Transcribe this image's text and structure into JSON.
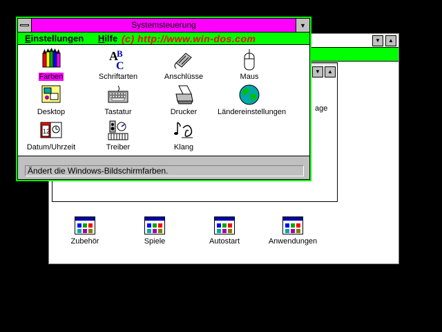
{
  "control_panel": {
    "title": "Systemsteuerung",
    "menu": [
      {
        "accel": "E",
        "rest": "instellungen"
      },
      {
        "accel": "H",
        "rest": "ilfe"
      }
    ],
    "brand_text": "(c) http://www.win-dos.com",
    "icons": [
      {
        "label": "Farben",
        "icon": "color-pencils-icon",
        "selected": true
      },
      {
        "label": "Schriftarten",
        "icon": "fonts-icon"
      },
      {
        "label": "Anschlüsse",
        "icon": "ports-icon"
      },
      {
        "label": "Maus",
        "icon": "mouse-icon"
      },
      {
        "label": "Desktop",
        "icon": "desktop-icon"
      },
      {
        "label": "Tastatur",
        "icon": "keyboard-icon"
      },
      {
        "label": "Drucker",
        "icon": "printer-icon"
      },
      {
        "label": "Ländereinstellungen",
        "icon": "globe-icon"
      },
      {
        "label": "Datum/Uhrzeit",
        "icon": "calendar-clock-icon"
      },
      {
        "label": "Treiber",
        "icon": "drivers-icon"
      },
      {
        "label": "Klang",
        "icon": "sound-icon"
      }
    ],
    "status": "Ändert die Windows-Bildschirmfarben."
  },
  "group_window": {
    "partial_label": "age"
  },
  "program_groups": [
    {
      "label": "Zubehör"
    },
    {
      "label": "Spiele"
    },
    {
      "label": "Autostart"
    },
    {
      "label": "Anwendungen"
    }
  ],
  "colors": {
    "menubar": "#00ff00",
    "titlebar": "#ff00ff",
    "brand": "#ff0000",
    "desktop": "#000000"
  }
}
